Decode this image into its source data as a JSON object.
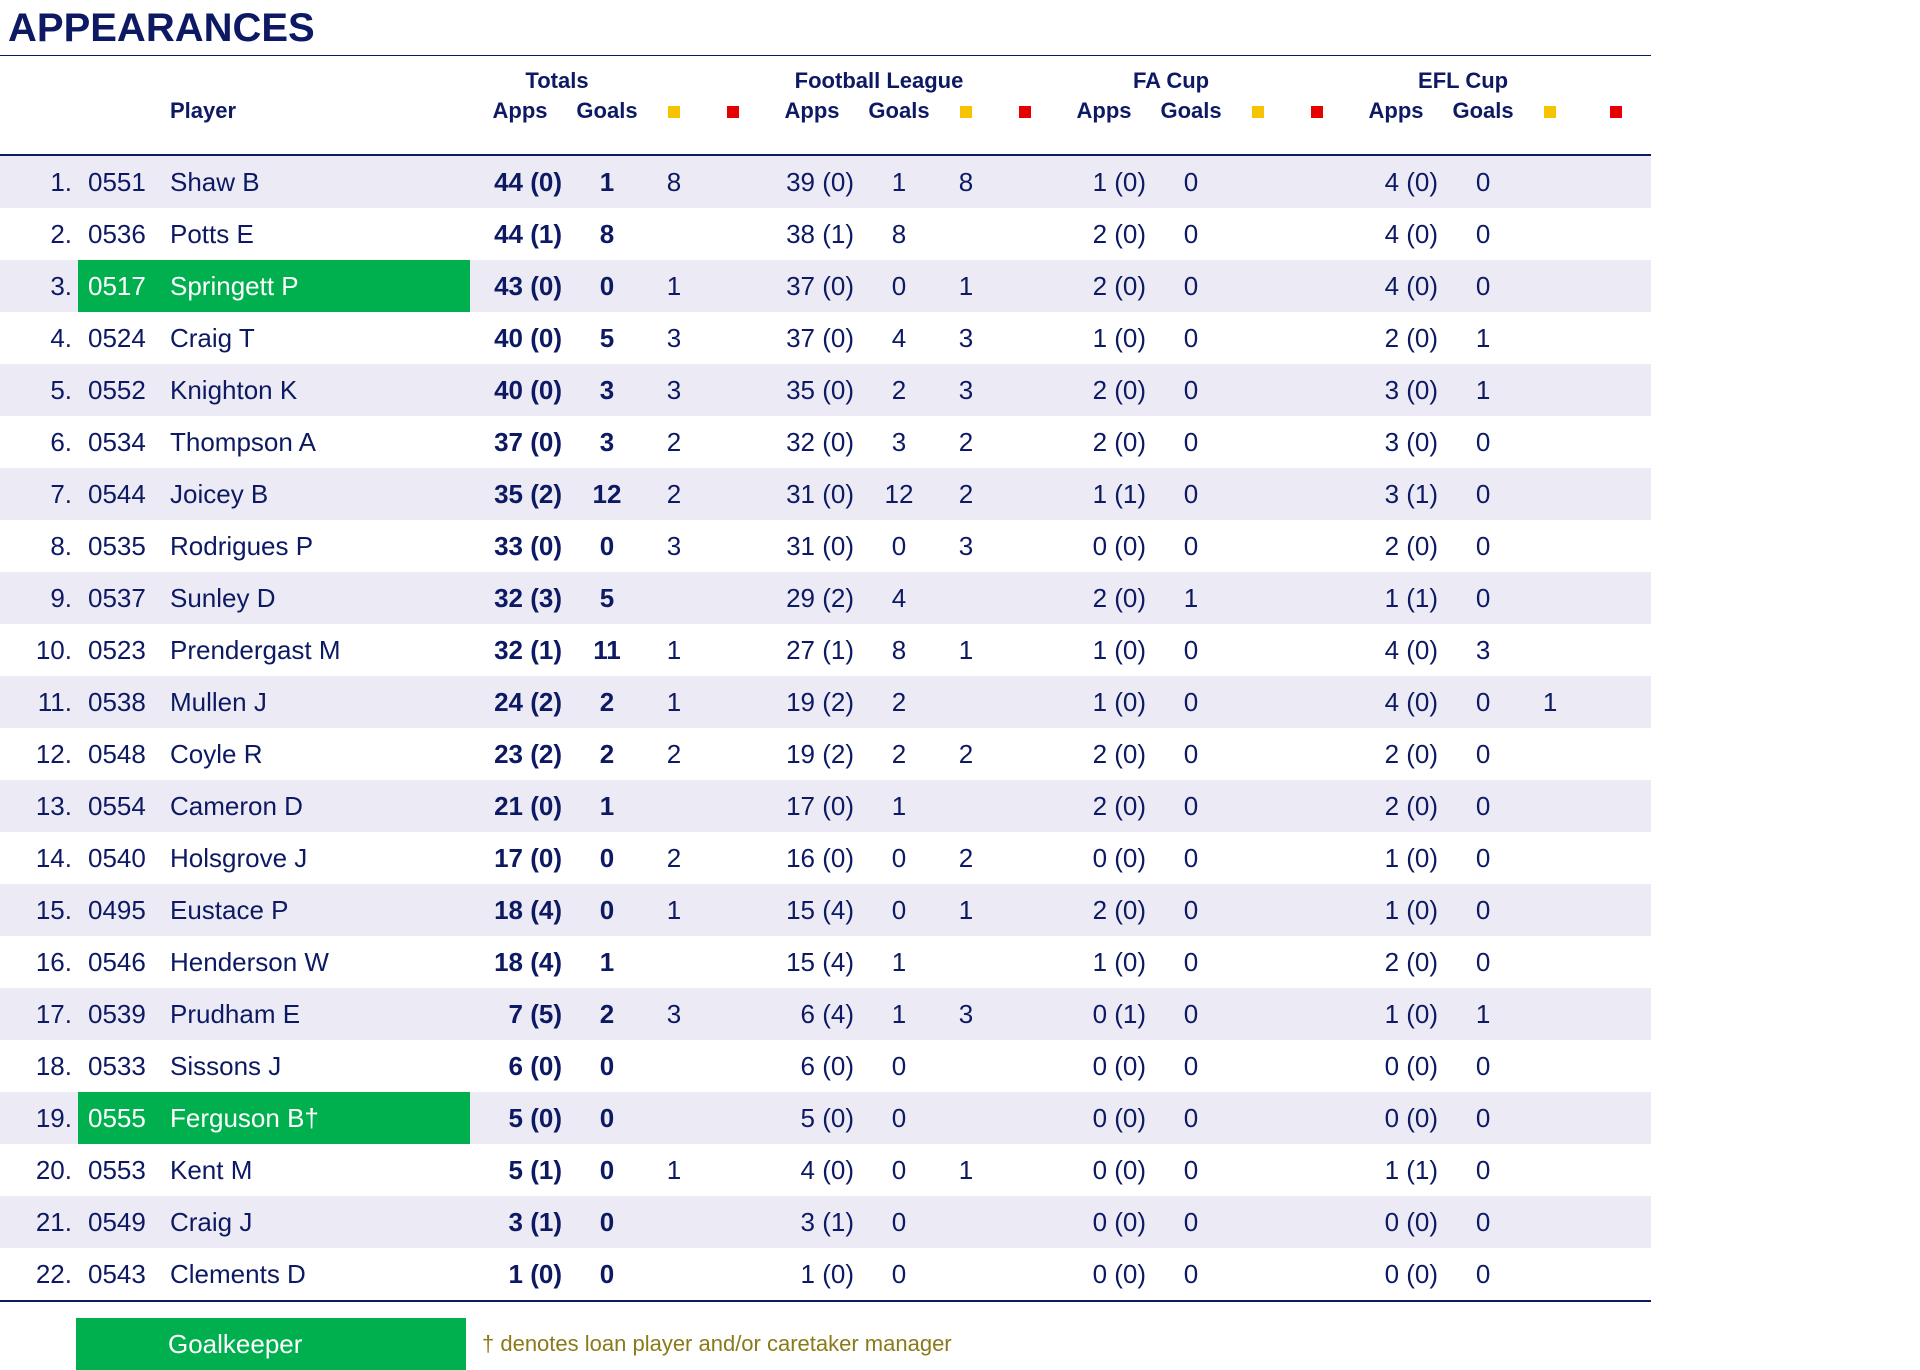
{
  "title": "APPEARANCES",
  "headers": {
    "player": "Player",
    "totals": "Totals",
    "league": "Football League",
    "facup": "FA Cup",
    "eflcup": "EFL Cup",
    "apps": "Apps",
    "goals": "Goals",
    "yellow_icon": "yellow-card-icon",
    "red_icon": "red-card-icon"
  },
  "colors": {
    "navy": "#0d1a63",
    "goalkeeper": "#00b04f",
    "yellow_card": "#f7c300",
    "red_card": "#e60000",
    "row_stripe": "#ecebf5",
    "note": "#8a7a1a"
  },
  "rows": [
    {
      "rank": "1.",
      "id": "0551",
      "name": "Shaw B",
      "gk": false,
      "t_apps": "44 (0)",
      "t_goals": "1",
      "t_y": "8",
      "t_r": "",
      "fl_apps": "39 (0)",
      "fl_goals": "1",
      "fl_y": "8",
      "fl_r": "",
      "fa_apps": "1 (0)",
      "fa_goals": "0",
      "fa_y": "",
      "fa_r": "",
      "efl_apps": "4 (0)",
      "efl_goals": "0",
      "efl_y": "",
      "efl_r": ""
    },
    {
      "rank": "2.",
      "id": "0536",
      "name": "Potts E",
      "gk": false,
      "t_apps": "44 (1)",
      "t_goals": "8",
      "t_y": "",
      "t_r": "",
      "fl_apps": "38 (1)",
      "fl_goals": "8",
      "fl_y": "",
      "fl_r": "",
      "fa_apps": "2 (0)",
      "fa_goals": "0",
      "fa_y": "",
      "fa_r": "",
      "efl_apps": "4 (0)",
      "efl_goals": "0",
      "efl_y": "",
      "efl_r": ""
    },
    {
      "rank": "3.",
      "id": "0517",
      "name": "Springett P",
      "gk": true,
      "t_apps": "43 (0)",
      "t_goals": "0",
      "t_y": "1",
      "t_r": "",
      "fl_apps": "37 (0)",
      "fl_goals": "0",
      "fl_y": "1",
      "fl_r": "",
      "fa_apps": "2 (0)",
      "fa_goals": "0",
      "fa_y": "",
      "fa_r": "",
      "efl_apps": "4 (0)",
      "efl_goals": "0",
      "efl_y": "",
      "efl_r": ""
    },
    {
      "rank": "4.",
      "id": "0524",
      "name": "Craig T",
      "gk": false,
      "t_apps": "40 (0)",
      "t_goals": "5",
      "t_y": "3",
      "t_r": "",
      "fl_apps": "37 (0)",
      "fl_goals": "4",
      "fl_y": "3",
      "fl_r": "",
      "fa_apps": "1 (0)",
      "fa_goals": "0",
      "fa_y": "",
      "fa_r": "",
      "efl_apps": "2 (0)",
      "efl_goals": "1",
      "efl_y": "",
      "efl_r": ""
    },
    {
      "rank": "5.",
      "id": "0552",
      "name": "Knighton K",
      "gk": false,
      "t_apps": "40 (0)",
      "t_goals": "3",
      "t_y": "3",
      "t_r": "",
      "fl_apps": "35 (0)",
      "fl_goals": "2",
      "fl_y": "3",
      "fl_r": "",
      "fa_apps": "2 (0)",
      "fa_goals": "0",
      "fa_y": "",
      "fa_r": "",
      "efl_apps": "3 (0)",
      "efl_goals": "1",
      "efl_y": "",
      "efl_r": ""
    },
    {
      "rank": "6.",
      "id": "0534",
      "name": "Thompson A",
      "gk": false,
      "t_apps": "37 (0)",
      "t_goals": "3",
      "t_y": "2",
      "t_r": "",
      "fl_apps": "32 (0)",
      "fl_goals": "3",
      "fl_y": "2",
      "fl_r": "",
      "fa_apps": "2 (0)",
      "fa_goals": "0",
      "fa_y": "",
      "fa_r": "",
      "efl_apps": "3 (0)",
      "efl_goals": "0",
      "efl_y": "",
      "efl_r": ""
    },
    {
      "rank": "7.",
      "id": "0544",
      "name": "Joicey B",
      "gk": false,
      "t_apps": "35 (2)",
      "t_goals": "12",
      "t_y": "2",
      "t_r": "",
      "fl_apps": "31 (0)",
      "fl_goals": "12",
      "fl_y": "2",
      "fl_r": "",
      "fa_apps": "1 (1)",
      "fa_goals": "0",
      "fa_y": "",
      "fa_r": "",
      "efl_apps": "3 (1)",
      "efl_goals": "0",
      "efl_y": "",
      "efl_r": ""
    },
    {
      "rank": "8.",
      "id": "0535",
      "name": "Rodrigues P",
      "gk": false,
      "t_apps": "33 (0)",
      "t_goals": "0",
      "t_y": "3",
      "t_r": "",
      "fl_apps": "31 (0)",
      "fl_goals": "0",
      "fl_y": "3",
      "fl_r": "",
      "fa_apps": "0 (0)",
      "fa_goals": "0",
      "fa_y": "",
      "fa_r": "",
      "efl_apps": "2 (0)",
      "efl_goals": "0",
      "efl_y": "",
      "efl_r": ""
    },
    {
      "rank": "9.",
      "id": "0537",
      "name": "Sunley D",
      "gk": false,
      "t_apps": "32 (3)",
      "t_goals": "5",
      "t_y": "",
      "t_r": "",
      "fl_apps": "29 (2)",
      "fl_goals": "4",
      "fl_y": "",
      "fl_r": "",
      "fa_apps": "2 (0)",
      "fa_goals": "1",
      "fa_y": "",
      "fa_r": "",
      "efl_apps": "1 (1)",
      "efl_goals": "0",
      "efl_y": "",
      "efl_r": ""
    },
    {
      "rank": "10.",
      "id": "0523",
      "name": "Prendergast M",
      "gk": false,
      "t_apps": "32 (1)",
      "t_goals": "11",
      "t_y": "1",
      "t_r": "",
      "fl_apps": "27 (1)",
      "fl_goals": "8",
      "fl_y": "1",
      "fl_r": "",
      "fa_apps": "1 (0)",
      "fa_goals": "0",
      "fa_y": "",
      "fa_r": "",
      "efl_apps": "4 (0)",
      "efl_goals": "3",
      "efl_y": "",
      "efl_r": ""
    },
    {
      "rank": "11.",
      "id": "0538",
      "name": "Mullen J",
      "gk": false,
      "t_apps": "24 (2)",
      "t_goals": "2",
      "t_y": "1",
      "t_r": "",
      "fl_apps": "19 (2)",
      "fl_goals": "2",
      "fl_y": "",
      "fl_r": "",
      "fa_apps": "1 (0)",
      "fa_goals": "0",
      "fa_y": "",
      "fa_r": "",
      "efl_apps": "4 (0)",
      "efl_goals": "0",
      "efl_y": "1",
      "efl_r": ""
    },
    {
      "rank": "12.",
      "id": "0548",
      "name": "Coyle R",
      "gk": false,
      "t_apps": "23 (2)",
      "t_goals": "2",
      "t_y": "2",
      "t_r": "",
      "fl_apps": "19 (2)",
      "fl_goals": "2",
      "fl_y": "2",
      "fl_r": "",
      "fa_apps": "2 (0)",
      "fa_goals": "0",
      "fa_y": "",
      "fa_r": "",
      "efl_apps": "2 (0)",
      "efl_goals": "0",
      "efl_y": "",
      "efl_r": ""
    },
    {
      "rank": "13.",
      "id": "0554",
      "name": "Cameron D",
      "gk": false,
      "t_apps": "21 (0)",
      "t_goals": "1",
      "t_y": "",
      "t_r": "",
      "fl_apps": "17 (0)",
      "fl_goals": "1",
      "fl_y": "",
      "fl_r": "",
      "fa_apps": "2 (0)",
      "fa_goals": "0",
      "fa_y": "",
      "fa_r": "",
      "efl_apps": "2 (0)",
      "efl_goals": "0",
      "efl_y": "",
      "efl_r": ""
    },
    {
      "rank": "14.",
      "id": "0540",
      "name": "Holsgrove J",
      "gk": false,
      "t_apps": "17 (0)",
      "t_goals": "0",
      "t_y": "2",
      "t_r": "",
      "fl_apps": "16 (0)",
      "fl_goals": "0",
      "fl_y": "2",
      "fl_r": "",
      "fa_apps": "0 (0)",
      "fa_goals": "0",
      "fa_y": "",
      "fa_r": "",
      "efl_apps": "1 (0)",
      "efl_goals": "0",
      "efl_y": "",
      "efl_r": ""
    },
    {
      "rank": "15.",
      "id": "0495",
      "name": "Eustace P",
      "gk": false,
      "t_apps": "18 (4)",
      "t_goals": "0",
      "t_y": "1",
      "t_r": "",
      "fl_apps": "15 (4)",
      "fl_goals": "0",
      "fl_y": "1",
      "fl_r": "",
      "fa_apps": "2 (0)",
      "fa_goals": "0",
      "fa_y": "",
      "fa_r": "",
      "efl_apps": "1 (0)",
      "efl_goals": "0",
      "efl_y": "",
      "efl_r": ""
    },
    {
      "rank": "16.",
      "id": "0546",
      "name": "Henderson W",
      "gk": false,
      "t_apps": "18 (4)",
      "t_goals": "1",
      "t_y": "",
      "t_r": "",
      "fl_apps": "15 (4)",
      "fl_goals": "1",
      "fl_y": "",
      "fl_r": "",
      "fa_apps": "1 (0)",
      "fa_goals": "0",
      "fa_y": "",
      "fa_r": "",
      "efl_apps": "2 (0)",
      "efl_goals": "0",
      "efl_y": "",
      "efl_r": ""
    },
    {
      "rank": "17.",
      "id": "0539",
      "name": "Prudham E",
      "gk": false,
      "t_apps": "7 (5)",
      "t_goals": "2",
      "t_y": "3",
      "t_r": "",
      "fl_apps": "6 (4)",
      "fl_goals": "1",
      "fl_y": "3",
      "fl_r": "",
      "fa_apps": "0 (1)",
      "fa_goals": "0",
      "fa_y": "",
      "fa_r": "",
      "efl_apps": "1 (0)",
      "efl_goals": "1",
      "efl_y": "",
      "efl_r": ""
    },
    {
      "rank": "18.",
      "id": "0533",
      "name": "Sissons J",
      "gk": false,
      "t_apps": "6 (0)",
      "t_goals": "0",
      "t_y": "",
      "t_r": "",
      "fl_apps": "6 (0)",
      "fl_goals": "0",
      "fl_y": "",
      "fl_r": "",
      "fa_apps": "0 (0)",
      "fa_goals": "0",
      "fa_y": "",
      "fa_r": "",
      "efl_apps": "0 (0)",
      "efl_goals": "0",
      "efl_y": "",
      "efl_r": ""
    },
    {
      "rank": "19.",
      "id": "0555",
      "name": "Ferguson B†",
      "gk": true,
      "t_apps": "5 (0)",
      "t_goals": "0",
      "t_y": "",
      "t_r": "",
      "fl_apps": "5 (0)",
      "fl_goals": "0",
      "fl_y": "",
      "fl_r": "",
      "fa_apps": "0 (0)",
      "fa_goals": "0",
      "fa_y": "",
      "fa_r": "",
      "efl_apps": "0 (0)",
      "efl_goals": "0",
      "efl_y": "",
      "efl_r": ""
    },
    {
      "rank": "20.",
      "id": "0553",
      "name": "Kent M",
      "gk": false,
      "t_apps": "5 (1)",
      "t_goals": "0",
      "t_y": "1",
      "t_r": "",
      "fl_apps": "4 (0)",
      "fl_goals": "0",
      "fl_y": "1",
      "fl_r": "",
      "fa_apps": "0 (0)",
      "fa_goals": "0",
      "fa_y": "",
      "fa_r": "",
      "efl_apps": "1 (1)",
      "efl_goals": "0",
      "efl_y": "",
      "efl_r": ""
    },
    {
      "rank": "21.",
      "id": "0549",
      "name": "Craig J",
      "gk": false,
      "t_apps": "3 (1)",
      "t_goals": "0",
      "t_y": "",
      "t_r": "",
      "fl_apps": "3 (1)",
      "fl_goals": "0",
      "fl_y": "",
      "fl_r": "",
      "fa_apps": "0 (0)",
      "fa_goals": "0",
      "fa_y": "",
      "fa_r": "",
      "efl_apps": "0 (0)",
      "efl_goals": "0",
      "efl_y": "",
      "efl_r": ""
    },
    {
      "rank": "22.",
      "id": "0543",
      "name": "Clements D",
      "gk": false,
      "t_apps": "1 (0)",
      "t_goals": "0",
      "t_y": "",
      "t_r": "",
      "fl_apps": "1 (0)",
      "fl_goals": "0",
      "fl_y": "",
      "fl_r": "",
      "fa_apps": "0 (0)",
      "fa_goals": "0",
      "fa_y": "",
      "fa_r": "",
      "efl_apps": "0 (0)",
      "efl_goals": "0",
      "efl_y": "",
      "efl_r": ""
    }
  ],
  "legend": {
    "goalkeeper_label": "Goalkeeper",
    "note": "† denotes loan player and/or caretaker manager"
  }
}
